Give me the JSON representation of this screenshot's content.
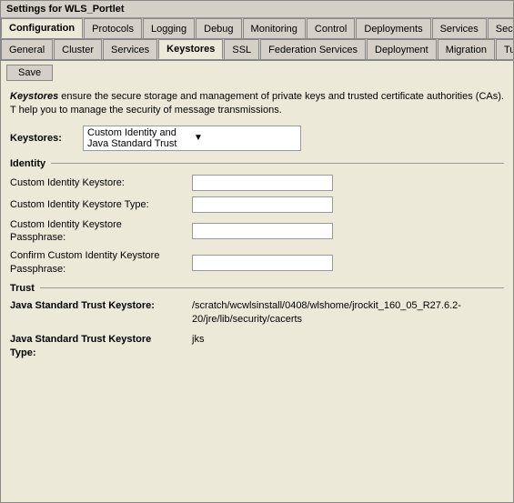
{
  "window": {
    "title": "Settings for WLS_Portlet"
  },
  "tabs_row1": {
    "items": [
      {
        "label": "Configuration",
        "active": true
      },
      {
        "label": "Protocols",
        "active": false
      },
      {
        "label": "Logging",
        "active": false
      },
      {
        "label": "Debug",
        "active": false
      },
      {
        "label": "Monitoring",
        "active": false
      },
      {
        "label": "Control",
        "active": false
      },
      {
        "label": "Deployments",
        "active": false
      },
      {
        "label": "Services",
        "active": false
      },
      {
        "label": "Securit...",
        "active": false
      }
    ]
  },
  "tabs_row2": {
    "items": [
      {
        "label": "General",
        "active": false
      },
      {
        "label": "Cluster",
        "active": false
      },
      {
        "label": "Services",
        "active": false
      },
      {
        "label": "Keystores",
        "active": true
      },
      {
        "label": "SSL",
        "active": false
      },
      {
        "label": "Federation Services",
        "active": false
      },
      {
        "label": "Deployment",
        "active": false
      },
      {
        "label": "Migration",
        "active": false
      },
      {
        "label": "Tuning...",
        "active": false
      }
    ]
  },
  "save_button": "Save",
  "description": {
    "italic": "Keystores",
    "text": " ensure the secure storage and management of private keys and trusted certificate authorities (CAs). T help you to manage the security of message transmissions."
  },
  "keystores": {
    "label": "Keystores:",
    "value": "Custom Identity and Java Standard Trust"
  },
  "identity_section": {
    "label": "Identity",
    "fields": [
      {
        "label": "Custom Identity Keystore:",
        "value": ""
      },
      {
        "label": "Custom Identity Keystore Type:",
        "value": ""
      },
      {
        "label": "Custom Identity Keystore Passphrase:",
        "value": ""
      },
      {
        "label": "Confirm Custom Identity Keystore Passphrase:",
        "value": ""
      }
    ]
  },
  "trust_section": {
    "label": "Trust",
    "fields": [
      {
        "label": "Java Standard Trust Keystore:",
        "value": "/scratch/wcwlsinstall/0408/wlshome/jrockit_160_05_R27.6.2-20/jre/lib/security/cacerts"
      },
      {
        "label": "Java Standard Trust Keystore Type:",
        "value": "jks"
      }
    ]
  }
}
